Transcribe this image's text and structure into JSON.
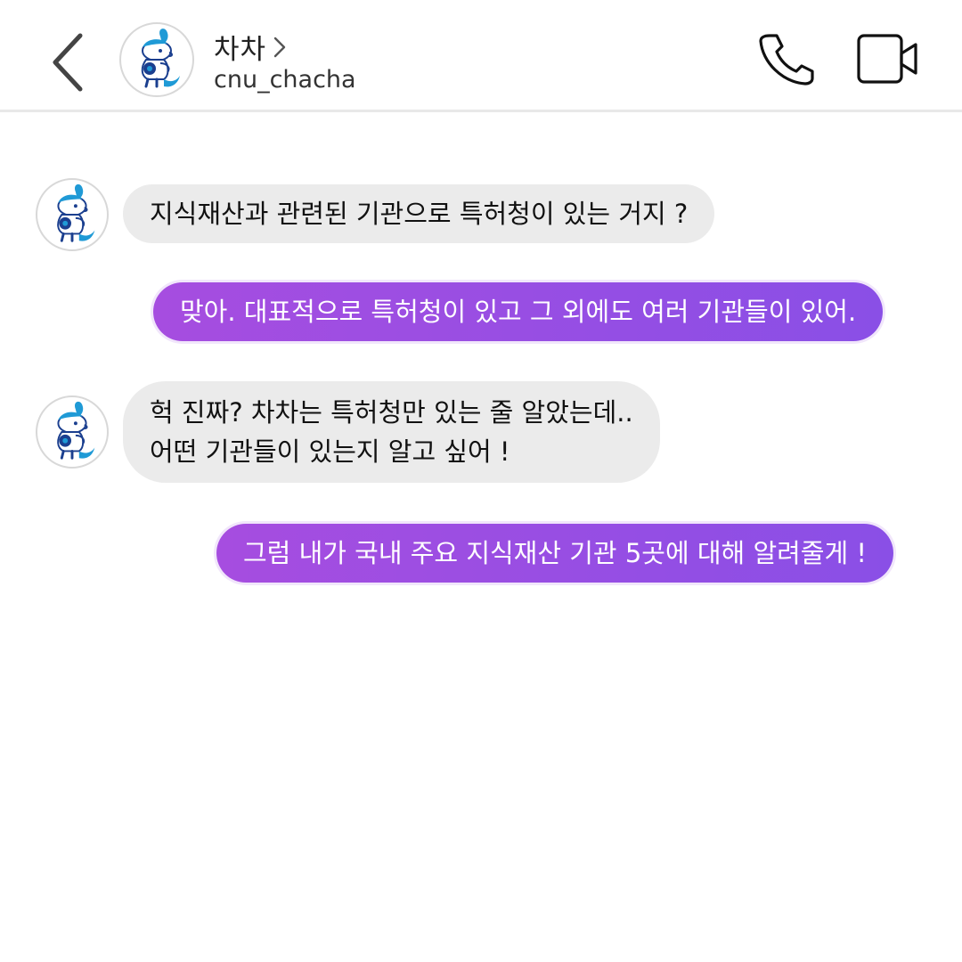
{
  "header": {
    "contact_name": "차차",
    "contact_handle": "cnu_chacha"
  },
  "messages": [
    {
      "sender": "contact",
      "lines": [
        "지식재산과 관련된 기관으로 특허청이 있는 거지 ?"
      ]
    },
    {
      "sender": "me",
      "lines": [
        "맞아. 대표적으로 특허청이 있고 그 외에도 여러 기관들이 있어."
      ]
    },
    {
      "sender": "contact",
      "lines": [
        "헉 진짜? 차차는 특허청만 있는 줄 알았는데..",
        "어떤 기관들이 있는지 알고 싶어 !"
      ]
    },
    {
      "sender": "me",
      "lines": [
        "그럼 내가 국내 주요 지식재산 기관 5곳에 대해 알려줄게 !"
      ]
    }
  ],
  "icons": {
    "back": "chevron-left-icon",
    "name_chevron": "chevron-right-icon",
    "call": "phone-icon",
    "video": "video-camera-icon",
    "avatar": "mascot-avatar"
  },
  "colors": {
    "incoming_bubble": "#ebebeb",
    "outgoing_bubble_start": "#a64de0",
    "outgoing_bubble_end": "#8a4fe6",
    "mascot_blue": "#1f9ad6",
    "mascot_navy": "#1b3f8f"
  }
}
